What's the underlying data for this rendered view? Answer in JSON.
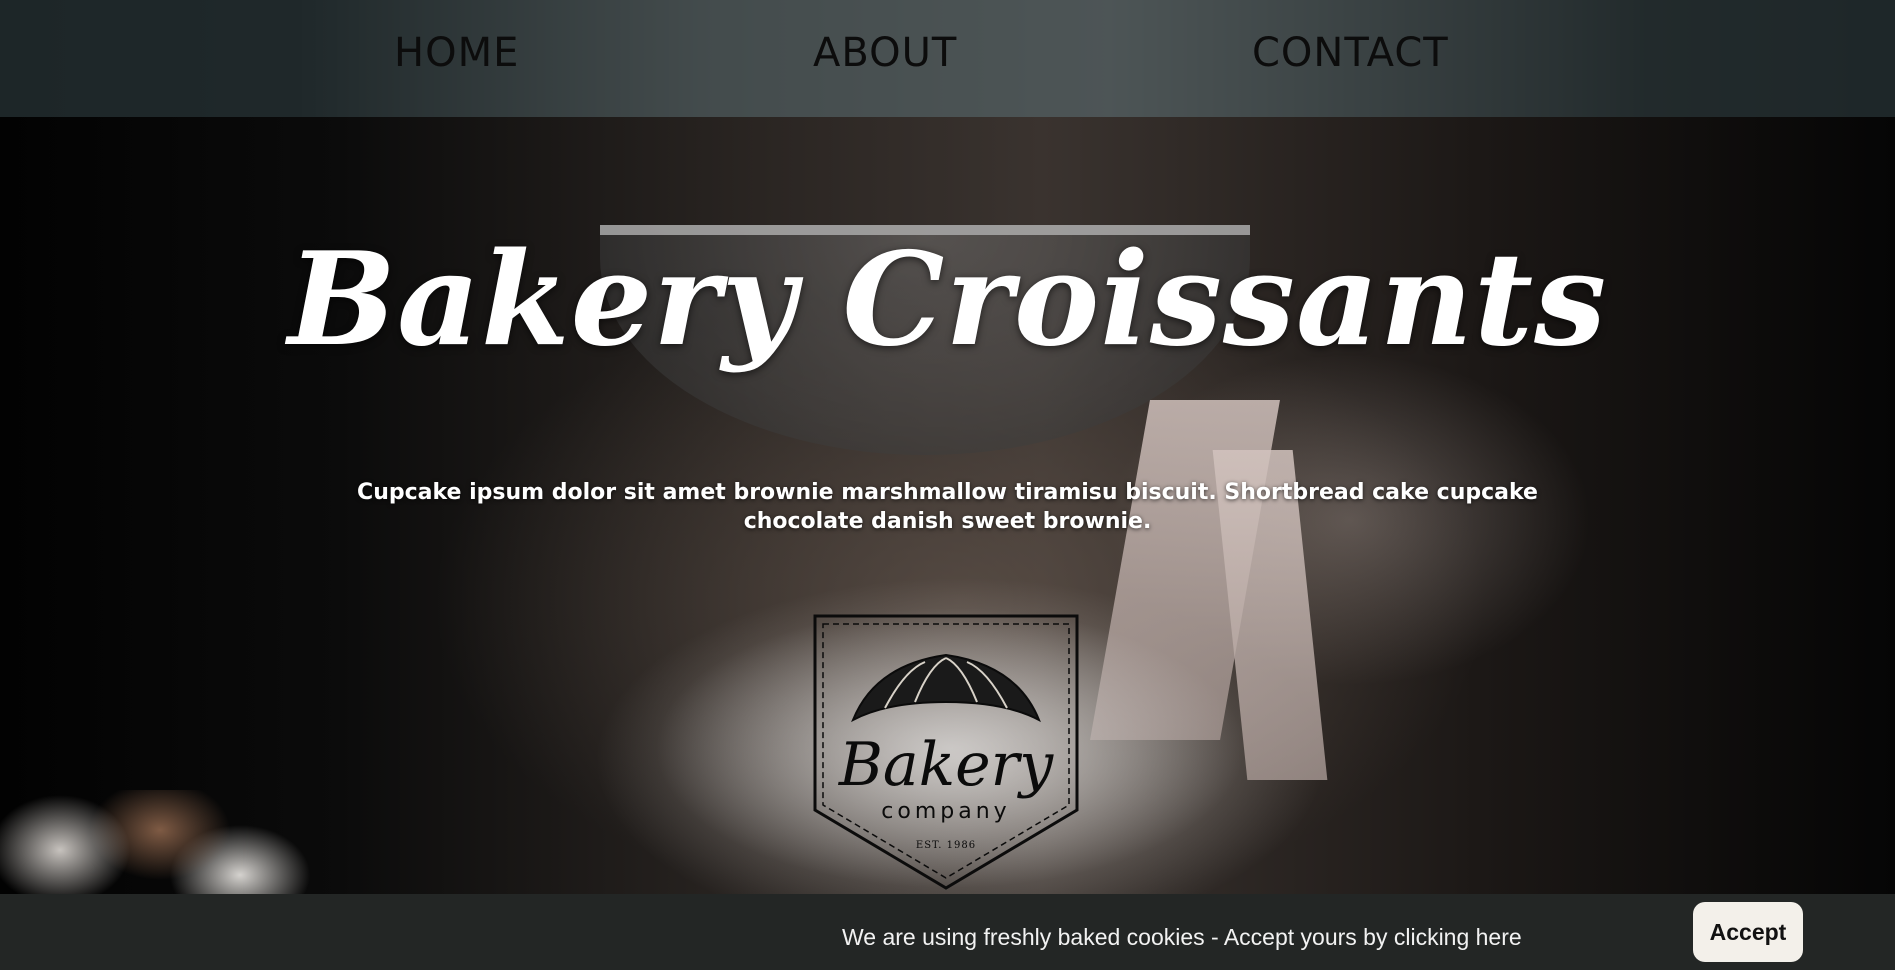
{
  "nav": {
    "home_label": "HOME",
    "about_label": "ABOUT",
    "contact_label": "CONTACT"
  },
  "hero": {
    "title": "Bakery Croissants",
    "description": "Cupcake ipsum dolor sit amet brownie marshmallow tiramisu biscuit. Shortbread cake cupcake chocolate danish sweet brownie."
  },
  "logo": {
    "icon": "croissant-icon",
    "main_text": "Bakery",
    "sub_text": "company",
    "est_text": "EST. 1986"
  },
  "cookie_banner": {
    "message": "We are using freshly baked cookies - Accept yours by clicking here",
    "accept_label": "Accept"
  },
  "colors": {
    "nav_bg": "#28343799",
    "cookie_bar_bg": "#232625",
    "accept_bg": "#f3f0ea",
    "title_text": "#ffffff"
  }
}
